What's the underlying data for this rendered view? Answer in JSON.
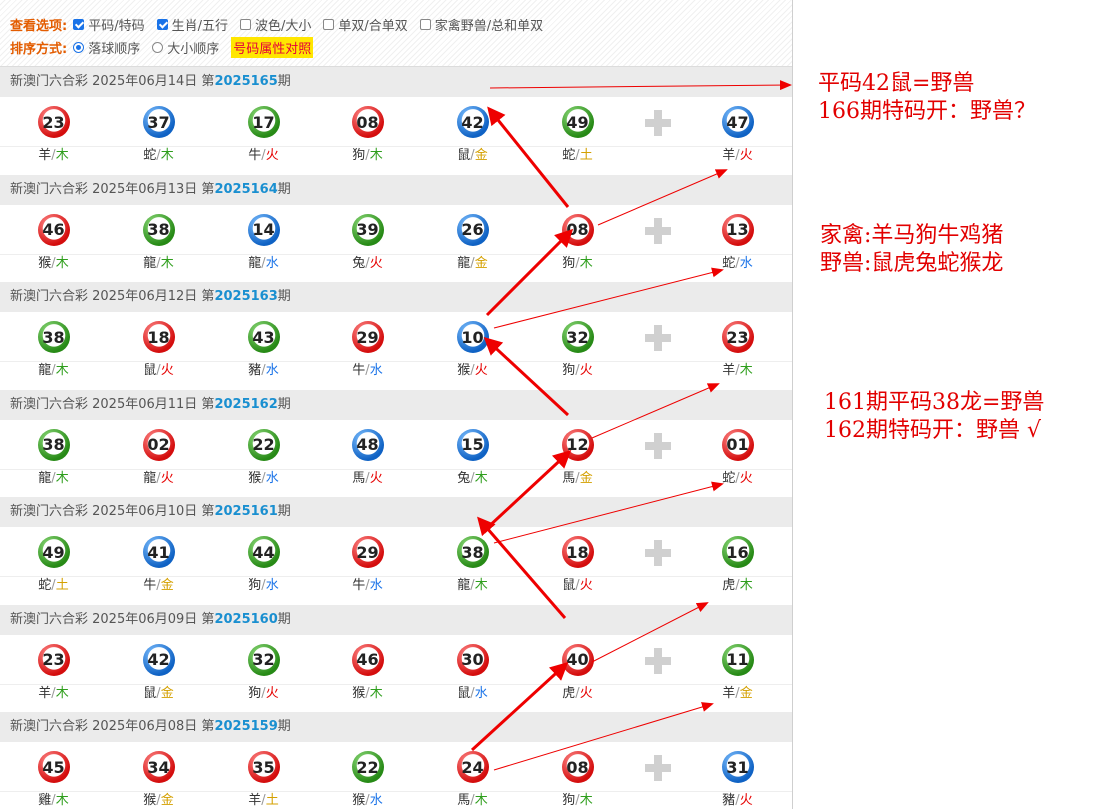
{
  "options": {
    "view_label": "查看选项:",
    "view_items": [
      {
        "label": "平码/特码",
        "checked": true
      },
      {
        "label": "生肖/五行",
        "checked": true
      },
      {
        "label": "波色/大小",
        "checked": false
      },
      {
        "label": "单双/合单双",
        "checked": false
      },
      {
        "label": "家禽野兽/总和单双",
        "checked": false
      }
    ],
    "sort_label": "排序方式:",
    "sort_items": [
      {
        "label": "落球顺序",
        "selected": true
      },
      {
        "label": "大小顺序",
        "selected": false
      }
    ],
    "attr_link": "号码属性对照"
  },
  "colors": {
    "red": "#e60000",
    "blue": "#1a73e8",
    "green": "#2e9e1c",
    "gold": "#d4a000",
    "issue": "#1a8fd0"
  },
  "draws": [
    {
      "prefix": "新澳门六合彩 2025年06月14日 第",
      "issue": "2025165",
      "suffix": "期",
      "balls": [
        {
          "n": "23",
          "c": "red",
          "z": "羊",
          "e": "木"
        },
        {
          "n": "37",
          "c": "blue",
          "z": "蛇",
          "e": "木"
        },
        {
          "n": "17",
          "c": "green",
          "z": "牛",
          "e": "火"
        },
        {
          "n": "08",
          "c": "red",
          "z": "狗",
          "e": "木"
        },
        {
          "n": "42",
          "c": "blue",
          "z": "鼠",
          "e": "金"
        },
        {
          "n": "49",
          "c": "green",
          "z": "蛇",
          "e": "土"
        },
        {
          "n": "47",
          "c": "blue",
          "z": "羊",
          "e": "火"
        }
      ]
    },
    {
      "prefix": "新澳门六合彩 2025年06月13日 第",
      "issue": "2025164",
      "suffix": "期",
      "balls": [
        {
          "n": "46",
          "c": "red",
          "z": "猴",
          "e": "木"
        },
        {
          "n": "38",
          "c": "green",
          "z": "龍",
          "e": "木"
        },
        {
          "n": "14",
          "c": "blue",
          "z": "龍",
          "e": "水"
        },
        {
          "n": "39",
          "c": "green",
          "z": "兔",
          "e": "火"
        },
        {
          "n": "26",
          "c": "blue",
          "z": "龍",
          "e": "金"
        },
        {
          "n": "08",
          "c": "red",
          "z": "狗",
          "e": "木"
        },
        {
          "n": "13",
          "c": "red",
          "z": "蛇",
          "e": "水"
        }
      ]
    },
    {
      "prefix": "新澳门六合彩 2025年06月12日 第",
      "issue": "2025163",
      "suffix": "期",
      "balls": [
        {
          "n": "38",
          "c": "green",
          "z": "龍",
          "e": "木"
        },
        {
          "n": "18",
          "c": "red",
          "z": "鼠",
          "e": "火"
        },
        {
          "n": "43",
          "c": "green",
          "z": "豬",
          "e": "水"
        },
        {
          "n": "29",
          "c": "red",
          "z": "牛",
          "e": "水"
        },
        {
          "n": "10",
          "c": "blue",
          "z": "猴",
          "e": "火"
        },
        {
          "n": "32",
          "c": "green",
          "z": "狗",
          "e": "火"
        },
        {
          "n": "23",
          "c": "red",
          "z": "羊",
          "e": "木"
        }
      ]
    },
    {
      "prefix": "新澳门六合彩 2025年06月11日 第",
      "issue": "2025162",
      "suffix": "期",
      "balls": [
        {
          "n": "38",
          "c": "green",
          "z": "龍",
          "e": "木"
        },
        {
          "n": "02",
          "c": "red",
          "z": "龍",
          "e": "火"
        },
        {
          "n": "22",
          "c": "green",
          "z": "猴",
          "e": "水"
        },
        {
          "n": "48",
          "c": "blue",
          "z": "馬",
          "e": "火"
        },
        {
          "n": "15",
          "c": "blue",
          "z": "兔",
          "e": "木"
        },
        {
          "n": "12",
          "c": "red",
          "z": "馬",
          "e": "金"
        },
        {
          "n": "01",
          "c": "red",
          "z": "蛇",
          "e": "火"
        }
      ]
    },
    {
      "prefix": "新澳门六合彩 2025年06月10日 第",
      "issue": "2025161",
      "suffix": "期",
      "balls": [
        {
          "n": "49",
          "c": "green",
          "z": "蛇",
          "e": "土"
        },
        {
          "n": "41",
          "c": "blue",
          "z": "牛",
          "e": "金"
        },
        {
          "n": "44",
          "c": "green",
          "z": "狗",
          "e": "水"
        },
        {
          "n": "29",
          "c": "red",
          "z": "牛",
          "e": "水"
        },
        {
          "n": "38",
          "c": "green",
          "z": "龍",
          "e": "木"
        },
        {
          "n": "18",
          "c": "red",
          "z": "鼠",
          "e": "火"
        },
        {
          "n": "16",
          "c": "green",
          "z": "虎",
          "e": "木"
        }
      ]
    },
    {
      "prefix": "新澳门六合彩 2025年06月09日 第",
      "issue": "2025160",
      "suffix": "期",
      "balls": [
        {
          "n": "23",
          "c": "red",
          "z": "羊",
          "e": "木"
        },
        {
          "n": "42",
          "c": "blue",
          "z": "鼠",
          "e": "金"
        },
        {
          "n": "32",
          "c": "green",
          "z": "狗",
          "e": "火"
        },
        {
          "n": "46",
          "c": "red",
          "z": "猴",
          "e": "木"
        },
        {
          "n": "30",
          "c": "red",
          "z": "鼠",
          "e": "水"
        },
        {
          "n": "40",
          "c": "red",
          "z": "虎",
          "e": "火"
        },
        {
          "n": "11",
          "c": "green",
          "z": "羊",
          "e": "金"
        }
      ]
    },
    {
      "prefix": "新澳门六合彩 2025年06月08日 第",
      "issue": "2025159",
      "suffix": "期",
      "balls": [
        {
          "n": "45",
          "c": "red",
          "z": "雞",
          "e": "木"
        },
        {
          "n": "34",
          "c": "red",
          "z": "猴",
          "e": "金"
        },
        {
          "n": "35",
          "c": "red",
          "z": "羊",
          "e": "土"
        },
        {
          "n": "22",
          "c": "green",
          "z": "猴",
          "e": "水"
        },
        {
          "n": "24",
          "c": "red",
          "z": "馬",
          "e": "木"
        },
        {
          "n": "08",
          "c": "red",
          "z": "狗",
          "e": "木"
        },
        {
          "n": "31",
          "c": "blue",
          "z": "豬",
          "e": "火"
        }
      ]
    }
  ],
  "annotations": {
    "note1_line1": "平码42鼠=野兽",
    "note1_line2": "166期特码开：野兽？",
    "note2_line1": "家禽:羊马狗牛鸡猪",
    "note2_line2": "野兽:鼠虎兔蛇猴龙",
    "note3_line1": "161期平码38龙=野兽",
    "note3_line2": "162期特码开：野兽 √"
  }
}
